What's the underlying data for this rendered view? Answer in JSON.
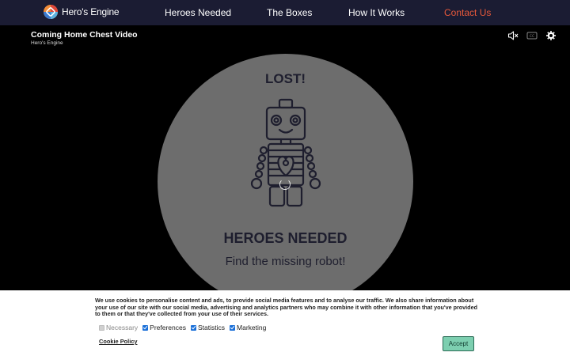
{
  "nav": {
    "logo_text": "Hero's Engine",
    "links": [
      "Heroes Needed",
      "The Boxes",
      "How It Works",
      "Contact Us"
    ],
    "accent_color": "#e8593a"
  },
  "video": {
    "title": "Coming Home Chest Video",
    "channel": "Hero's Engine",
    "lost_text": "LOST!",
    "heroes_text": "HEROES NEEDED",
    "find_text": "Find the missing robot!",
    "controls": [
      "mute-icon",
      "captions-icon",
      "settings-icon"
    ]
  },
  "cookie": {
    "text": "We use cookies to personalise content and ads, to provide social media features and to analyse our traffic. We also share information about your use of our site with our social media, advertising and analytics partners who may combine it with other information that you've provided to them or that they've collected from your use of their services.",
    "options": [
      {
        "label": "Necessary",
        "checked": true,
        "disabled": true
      },
      {
        "label": "Preferences",
        "checked": true,
        "disabled": false
      },
      {
        "label": "Statistics",
        "checked": true,
        "disabled": false
      },
      {
        "label": "Marketing",
        "checked": true,
        "disabled": false
      }
    ],
    "policy_label": "Cookie Policy",
    "accept_label": "Accept"
  }
}
